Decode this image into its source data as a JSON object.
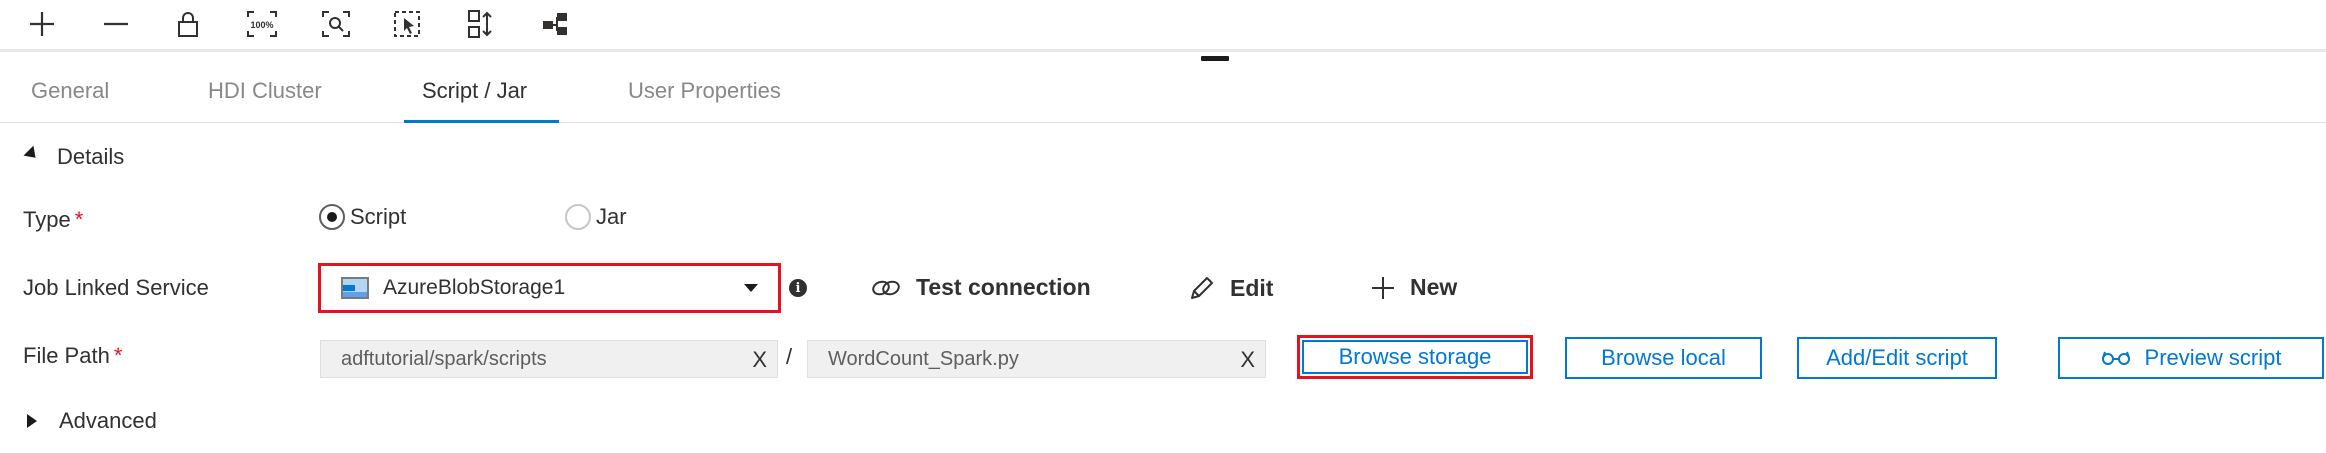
{
  "toolbar": {
    "buttons": [
      {
        "icon": "plus-icon"
      },
      {
        "icon": "minus-icon"
      },
      {
        "icon": "lock-icon"
      },
      {
        "icon": "zoom-100-icon",
        "text": "100%"
      },
      {
        "icon": "zoom-fit-icon"
      },
      {
        "icon": "select-icon"
      },
      {
        "icon": "auto-align-icon"
      },
      {
        "icon": "layout-icon"
      }
    ]
  },
  "tabs": [
    {
      "label": "General",
      "active": false
    },
    {
      "label": "HDI Cluster",
      "active": false
    },
    {
      "label": "Script / Jar",
      "active": true
    },
    {
      "label": "User Properties",
      "active": false
    }
  ],
  "details": {
    "header": "Details",
    "type": {
      "label": "Type",
      "required_mark": "*",
      "options": [
        {
          "label": "Script",
          "selected": true
        },
        {
          "label": "Jar",
          "selected": false
        }
      ]
    },
    "linked_service": {
      "label": "Job Linked Service",
      "value": "AzureBlobStorage1",
      "info": "i",
      "actions": {
        "test_connection": "Test connection",
        "edit": "Edit",
        "new": "New"
      }
    },
    "file_path": {
      "label": "File Path",
      "required_mark": "*",
      "folder": "adftutorial/spark/scripts",
      "file": "WordCount_Spark.py",
      "clear": "X",
      "separator": "/",
      "buttons": {
        "browse_storage": "Browse storage",
        "browse_local": "Browse local",
        "add_edit_script": "Add/Edit script",
        "preview_script": "Preview script"
      }
    }
  },
  "advanced": {
    "header": "Advanced"
  },
  "colors": {
    "accent": "#0078d4",
    "highlight": "#e81123",
    "required": "#e81123"
  }
}
